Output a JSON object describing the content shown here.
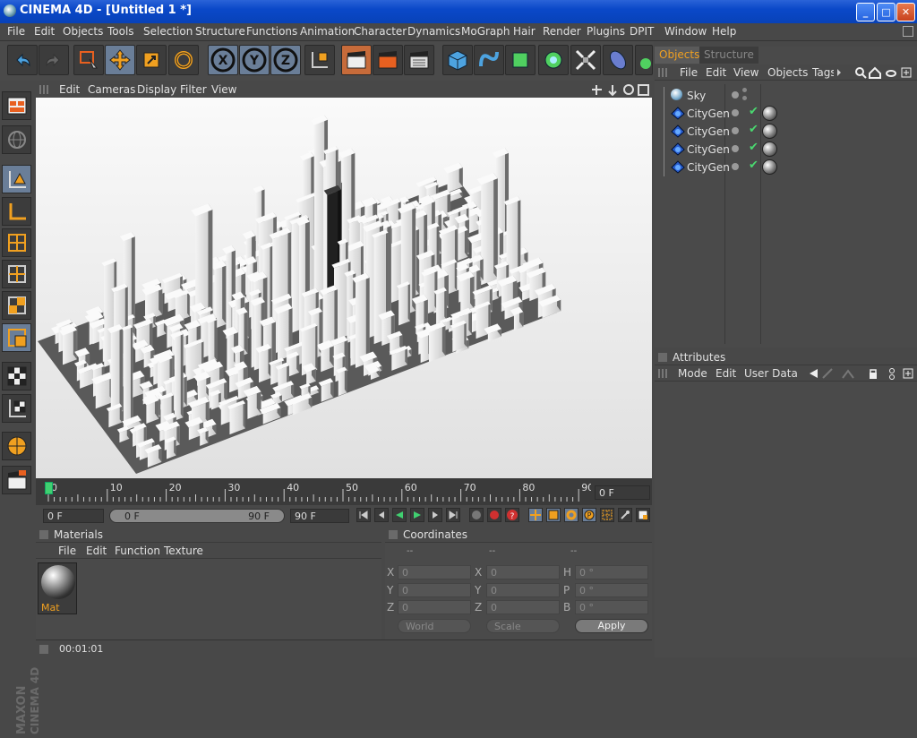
{
  "window": {
    "title": "CINEMA 4D - [Untitled 1 *]",
    "min": "_",
    "max": "□",
    "close": "✕"
  },
  "menu": [
    "File",
    "Edit",
    "Objects",
    "Tools",
    "Selection",
    "Structure",
    "Functions",
    "Animation",
    "Character",
    "Dynamics",
    "MoGraph",
    "Hair",
    "Render",
    "Plugins",
    "DPIT",
    "Window",
    "Help"
  ],
  "toolbar": {
    "axis_x": "X",
    "axis_y": "Y",
    "axis_z": "Z"
  },
  "viewport": {
    "menu": [
      "Edit",
      "Cameras",
      "Display",
      "Filter",
      "View"
    ]
  },
  "timeline": {
    "ticks": [
      "0",
      "10",
      "20",
      "30",
      "40",
      "50",
      "60",
      "70",
      "80",
      "90"
    ],
    "current_frame": "0 F",
    "start": "0 F",
    "range_start": "0 F",
    "range_end": "90 F",
    "end": "90 F"
  },
  "materials": {
    "title": "Materials",
    "menu": [
      "File",
      "Edit",
      "Function",
      "Texture"
    ],
    "items": [
      {
        "name": "Mat"
      }
    ]
  },
  "coordinates": {
    "title": "Coordinates",
    "cols": [
      "--",
      "--",
      "--"
    ],
    "rows": [
      {
        "l1": "X",
        "v1": "0",
        "l2": "X",
        "v2": "0",
        "l3": "H",
        "v3": "0 °"
      },
      {
        "l1": "Y",
        "v1": "0",
        "l2": "Y",
        "v2": "0",
        "l3": "P",
        "v3": "0 °"
      },
      {
        "l1": "Z",
        "v1": "0",
        "l2": "Z",
        "v2": "0",
        "l3": "B",
        "v3": "0 °"
      }
    ],
    "mode": "World",
    "size_mode": "Scale",
    "apply": "Apply"
  },
  "status": {
    "time": "00:01:01"
  },
  "objects": {
    "tabs": [
      "Objects",
      "Structure"
    ],
    "menu": [
      "File",
      "Edit",
      "View",
      "Objects",
      "Tags"
    ],
    "items": [
      {
        "name": "Sky"
      },
      {
        "name": "CityGen"
      },
      {
        "name": "CityGen"
      },
      {
        "name": "CityGen"
      },
      {
        "name": "CityGen"
      }
    ]
  },
  "attributes": {
    "title": "Attributes",
    "menu": [
      "Mode",
      "Edit",
      "User Data"
    ]
  },
  "brand": {
    "line1": "MAXON",
    "line2": "CINEMA 4D"
  },
  "colors": {
    "accent": "#f0a020",
    "selected": "#6a7e98",
    "title": "#0a48c8"
  }
}
